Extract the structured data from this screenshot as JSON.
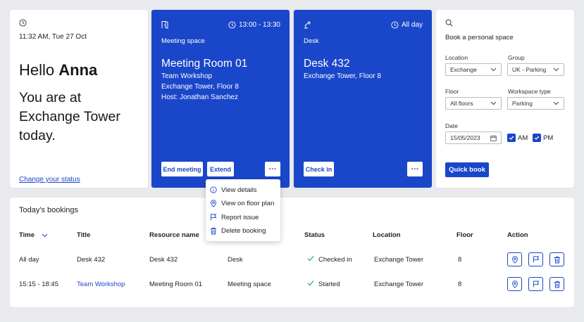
{
  "welcome": {
    "time": "11:32 AM, Tue 27 Oct",
    "greeting": "Hello",
    "name": "Anna",
    "location_msg": "You are at Exchange Tower today.",
    "change_status": "Change your status"
  },
  "meeting_card": {
    "time": "13:00 - 13:30",
    "type": "Meeting space",
    "title": "Meeting Room 01",
    "lines": [
      "Team Workshop",
      "Exchange Tower, Floor 8",
      "Host: Jonathan Sanchez"
    ],
    "end_label": "End meeting",
    "extend_label": "Extend",
    "more_label": "···"
  },
  "desk_card": {
    "time": "All day",
    "type": "Desk",
    "title": "Desk 432",
    "lines": [
      "Exchange Tower, Floor 8"
    ],
    "checkin_label": "Check in",
    "more_label": "···"
  },
  "book": {
    "heading": "Book a personal space",
    "location_label": "Location",
    "location_value": "Exchange",
    "group_label": "Group",
    "group_value": "UK - Parking",
    "floor_label": "Floor",
    "floor_value": "All floors",
    "worktype_label": "Workspace type",
    "worktype_value": "Parking",
    "date_label": "Date",
    "date_value": "15/05/2023",
    "am_label": "AM",
    "pm_label": "PM",
    "quick_book": "Quick book"
  },
  "menu": {
    "items": [
      "View details",
      "View on floor plan",
      "Report issue",
      "Delete booking"
    ]
  },
  "bookings": {
    "title": "Today's bookings",
    "headers": [
      "Time",
      "Title",
      "Resource name",
      "Status",
      "Location",
      "Floor",
      "Action"
    ],
    "rows": [
      {
        "time": "All day",
        "title": "Desk 432",
        "resource": "Desk 432",
        "type": "Desk",
        "status": "Checked in",
        "location": "Exchange Tower",
        "floor": "8"
      },
      {
        "time": "15:15 - 18:45",
        "title": "Team Workshop",
        "resource": "Meeting Room 01",
        "type": "Meeting space",
        "status": "Started",
        "location": "Exchange Tower",
        "floor": "8"
      }
    ]
  },
  "colors": {
    "primary": "#1a46c9",
    "success": "#2ea65a",
    "background": "#e9eaee"
  }
}
